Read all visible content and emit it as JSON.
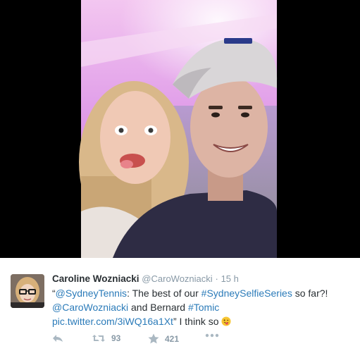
{
  "tweet": {
    "author_name": "Caroline Wozniacki",
    "author_handle": "@CaroWozniacki",
    "separator": "·",
    "time": "15 h",
    "text": {
      "open_quote": "“",
      "mention_1": "@SydneyTennis",
      "part_1": ": The best of our ",
      "hashtag_1": "#SydneySelfieSeries",
      "part_2": " so far?!",
      "mention_2": "@CaroWozniacki",
      "part_3": " and Bernard ",
      "hashtag_2": "#Tomic",
      "link": "pic.twitter.com/3iWQ16a1Xt",
      "part_4": "” I think so "
    },
    "emoji": "tongue-winking-emoji",
    "actions": {
      "reply_icon": "reply-icon",
      "retweet_icon": "retweet-icon",
      "retweet_count": "93",
      "favorite_icon": "star-icon",
      "favorite_count": "421",
      "more_icon": "more-dots-icon"
    }
  },
  "colors": {
    "link": "#2b7bb9",
    "name": "#292f33",
    "muted": "#8899a6",
    "action_icon": "#aab8c2"
  }
}
